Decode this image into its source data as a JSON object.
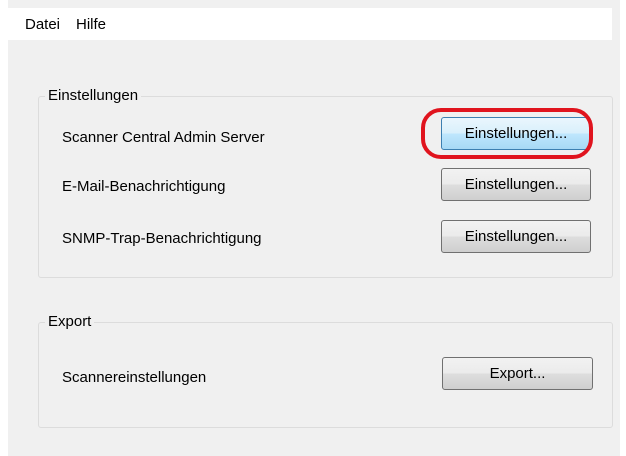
{
  "menu": {
    "items": [
      {
        "label": "Datei"
      },
      {
        "label": "Hilfe"
      }
    ]
  },
  "settings_group": {
    "title": "Einstellungen",
    "rows": [
      {
        "label": "Scanner Central Admin Server",
        "button": "Einstellungen...",
        "focused": true
      },
      {
        "label": "E-Mail-Benachrichtigung",
        "button": "Einstellungen..."
      },
      {
        "label": "SNMP-Trap-Benachrichtigung",
        "button": "Einstellungen..."
      }
    ]
  },
  "export_group": {
    "title": "Export",
    "rows": [
      {
        "label": "Scannereinstellungen",
        "button": "Export..."
      }
    ]
  },
  "colors": {
    "highlight": "#e0141e",
    "focus_border": "#3c7fb1",
    "background": "#f0f0f0"
  }
}
